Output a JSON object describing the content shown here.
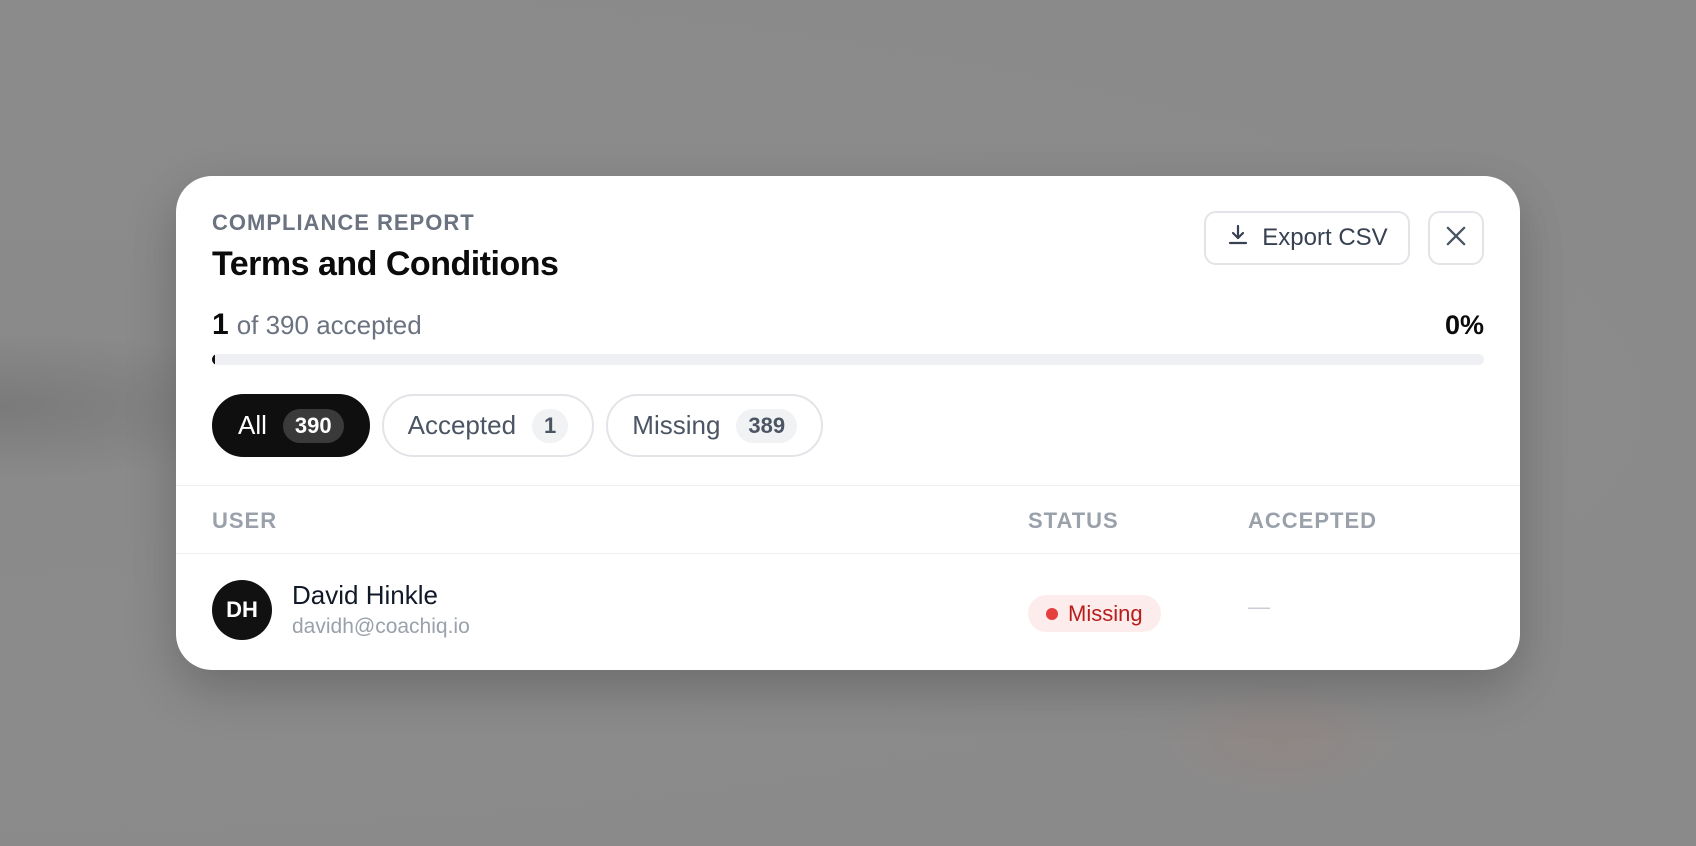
{
  "modal": {
    "eyebrow": "COMPLIANCE REPORT",
    "title": "Terms and Conditions",
    "export_label": "Export CSV"
  },
  "progress": {
    "accepted_count": "1",
    "summary": "of 390 accepted",
    "percent_label": "0%",
    "fraction": 0.0026
  },
  "tabs": [
    {
      "label": "All",
      "count": "390",
      "active": true
    },
    {
      "label": "Accepted",
      "count": "1",
      "active": false
    },
    {
      "label": "Missing",
      "count": "389",
      "active": false
    }
  ],
  "table": {
    "columns": [
      "USER",
      "STATUS",
      "ACCEPTED"
    ],
    "rows": [
      {
        "initials": "DH",
        "name": "David Hinkle",
        "email": "davidh@coachiq.io",
        "status": "Missing",
        "accepted": "—"
      }
    ]
  },
  "colors": {
    "status_missing_bg": "#fdecec",
    "status_missing_text": "#b91c1c",
    "status_missing_dot": "#e53e3e",
    "active_tab_bg": "#0f0f0f"
  },
  "icons": {
    "export": "download-icon",
    "close": "close-icon"
  }
}
